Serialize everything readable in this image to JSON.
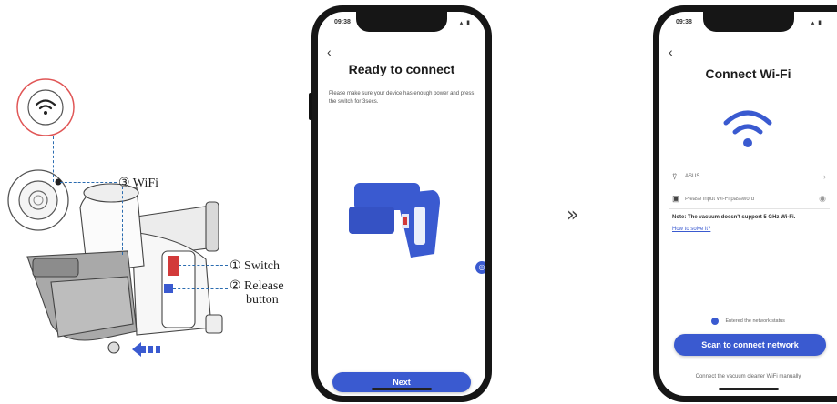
{
  "diagram": {
    "wifi_label": "③ WiFi",
    "switch_label": "① Switch",
    "release_label": "② Release",
    "release_label2": "button"
  },
  "separator": "»",
  "screen1": {
    "status_time": "09:38",
    "status_icons": "▴ ▮",
    "title": "Ready to connect",
    "description": "Please make sure your device has enough power and press the switch for 3secs.",
    "next_button": "Next"
  },
  "screen2": {
    "status_time": "09:38",
    "status_icons": "▴ ▮",
    "title": "Connect Wi-Fi",
    "network_name": "ASUS",
    "password_placeholder": "Please input Wi-Fi password",
    "note": "Note: The vacuum doesn't support 5 GHz Wi-Fi.",
    "help_link": "How to solve it?",
    "checkbox_label": "Entered the network status",
    "scan_button": "Scan to connect network",
    "manual_link": "Connect the vacuum cleaner WiFi manually"
  },
  "colors": {
    "accent": "#3a5ad0",
    "dash": "#2b6cb0",
    "switch_red": "#d23a3a"
  }
}
